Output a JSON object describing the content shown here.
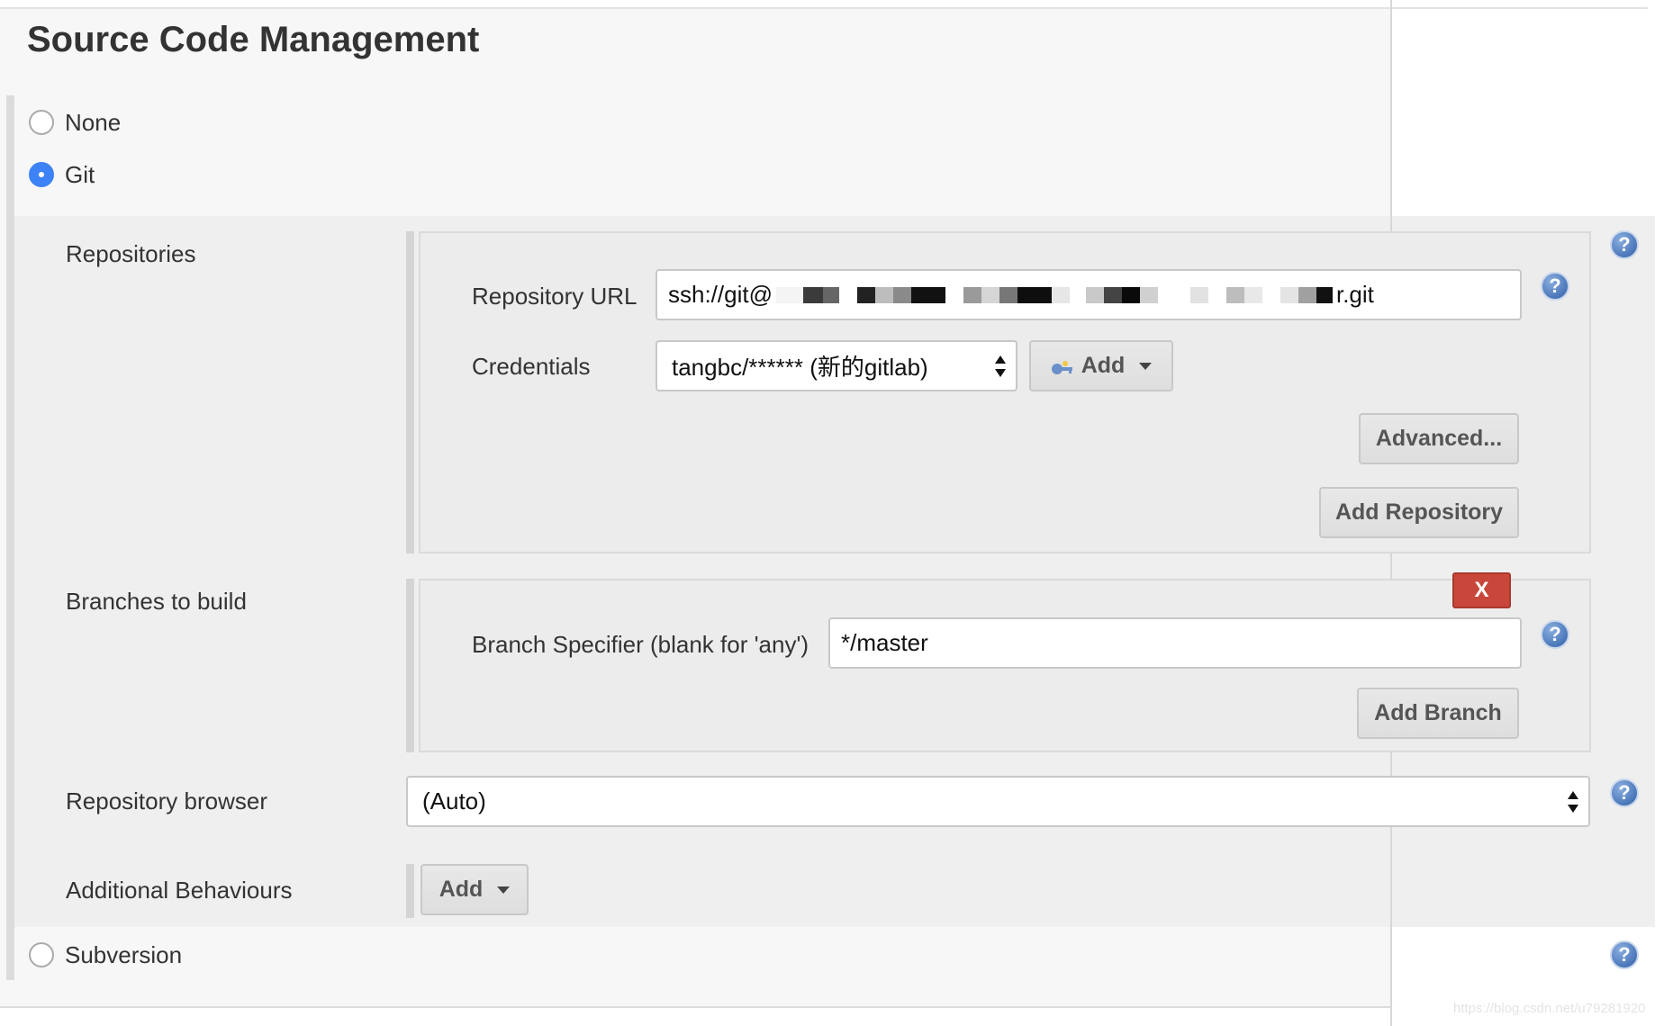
{
  "section": {
    "title": "Source Code Management"
  },
  "scm_options": {
    "none_label": "None",
    "git_label": "Git",
    "subversion_label": "Subversion",
    "selected": "Git"
  },
  "git": {
    "repositories_label": "Repositories",
    "repository_url_label": "Repository URL",
    "repository_url_prefix": "ssh://git@",
    "repository_url_suffix": "r.git",
    "credentials_label": "Credentials",
    "credentials_value": "tangbc/****** (新的gitlab)",
    "credentials_add_label": "Add",
    "advanced_label": "Advanced...",
    "add_repository_label": "Add Repository",
    "branches_label": "Branches to build",
    "branch_delete_label": "X",
    "branch_specifier_label": "Branch Specifier (blank for 'any')",
    "branch_specifier_value": "*/master",
    "add_branch_label": "Add Branch",
    "repo_browser_label": "Repository browser",
    "repo_browser_value": "(Auto)",
    "additional_behaviours_label": "Additional Behaviours",
    "additional_behaviours_add_label": "Add"
  },
  "help": {
    "glyph": "?"
  },
  "watermark": "https://blog.csdn.net/u79281920",
  "colors": {
    "radio_selected": "#3d82f6",
    "delete_button": "#c9473a",
    "help_icon": "#2f5fa8"
  }
}
